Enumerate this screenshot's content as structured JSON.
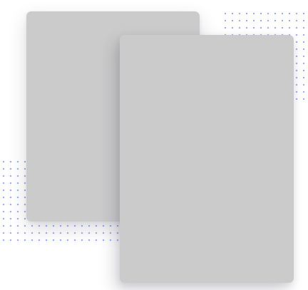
{
  "colors": {
    "card_fill": "#cbcbcb",
    "dot_pattern": "#9aa8f0",
    "background": "#ffffff"
  },
  "elements": {
    "back_card": "placeholder-card",
    "front_card": "placeholder-card",
    "dot_patterns": [
      "dot-grid-top-right",
      "dot-grid-bottom-left"
    ]
  }
}
